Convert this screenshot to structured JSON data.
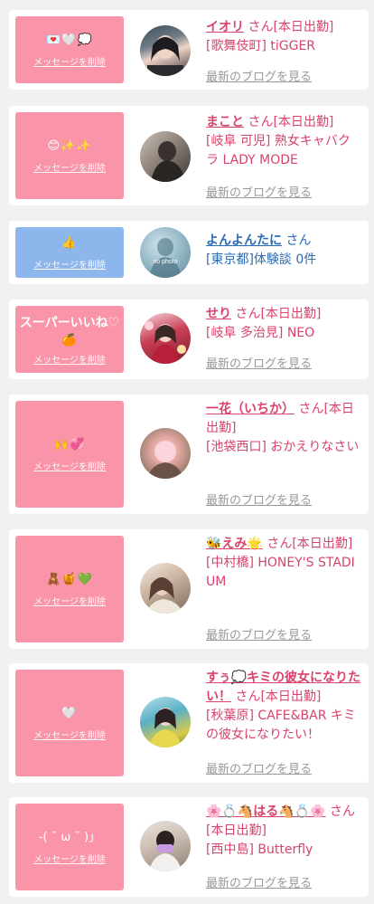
{
  "delete_label": "メッセージを削除",
  "blog_label": "最新のブログを見る",
  "san_label": "さん",
  "nophoto_label": "no photo",
  "colors": {
    "pink": "#f994a9",
    "blue": "#8cb6ec",
    "name_pink": "#d8436b",
    "name_blue": "#2a6bb5",
    "gray_link": "#999999"
  },
  "entries": [
    {
      "message": "💌🤍💭",
      "name": "イオリ",
      "status": "[本日出勤]",
      "location": "[歌舞伎町] tiGGER",
      "bubble_color": "pink"
    },
    {
      "message": "😊✨✨",
      "name": "まこと",
      "status": "[本日出勤]",
      "location": "[岐阜 可児] 熟女キャバクラ LADY MODE",
      "bubble_color": "pink"
    },
    {
      "message": "👍",
      "name": "よんよんたに",
      "status": "",
      "location": "[東京都]体験談 0件",
      "bubble_color": "blue"
    },
    {
      "message": "スーパーいいね♡",
      "message2": "🍊",
      "name": "せり",
      "status": "[本日出勤]",
      "location": "[岐阜 多治見] NEO",
      "bubble_color": "pink"
    },
    {
      "message": "🙌💞",
      "name": "一花（いちか）",
      "status": "[本日出勤]",
      "location": "[池袋西口] おかえりなさい",
      "bubble_color": "pink"
    },
    {
      "message": "🧸🍯💚",
      "name": "🐝えみ🌟",
      "status": "[本日出勤]",
      "location": "[中村橋] HONEY'S STADIUM",
      "bubble_color": "pink"
    },
    {
      "message": "🤍",
      "name": "すぅ💭キミの彼女になりたい！",
      "status": "[本日出勤]",
      "location": "[秋葉原] CAFE&BAR キミの彼女になりたい！",
      "bubble_color": "pink"
    },
    {
      "message": "-( ˘ ω ˘ )」",
      "name": "🌸💍🐴はる🐴💍🌸",
      "status": "[本日出勤]",
      "location": "[西中島] Butterfly",
      "bubble_color": "pink"
    }
  ]
}
